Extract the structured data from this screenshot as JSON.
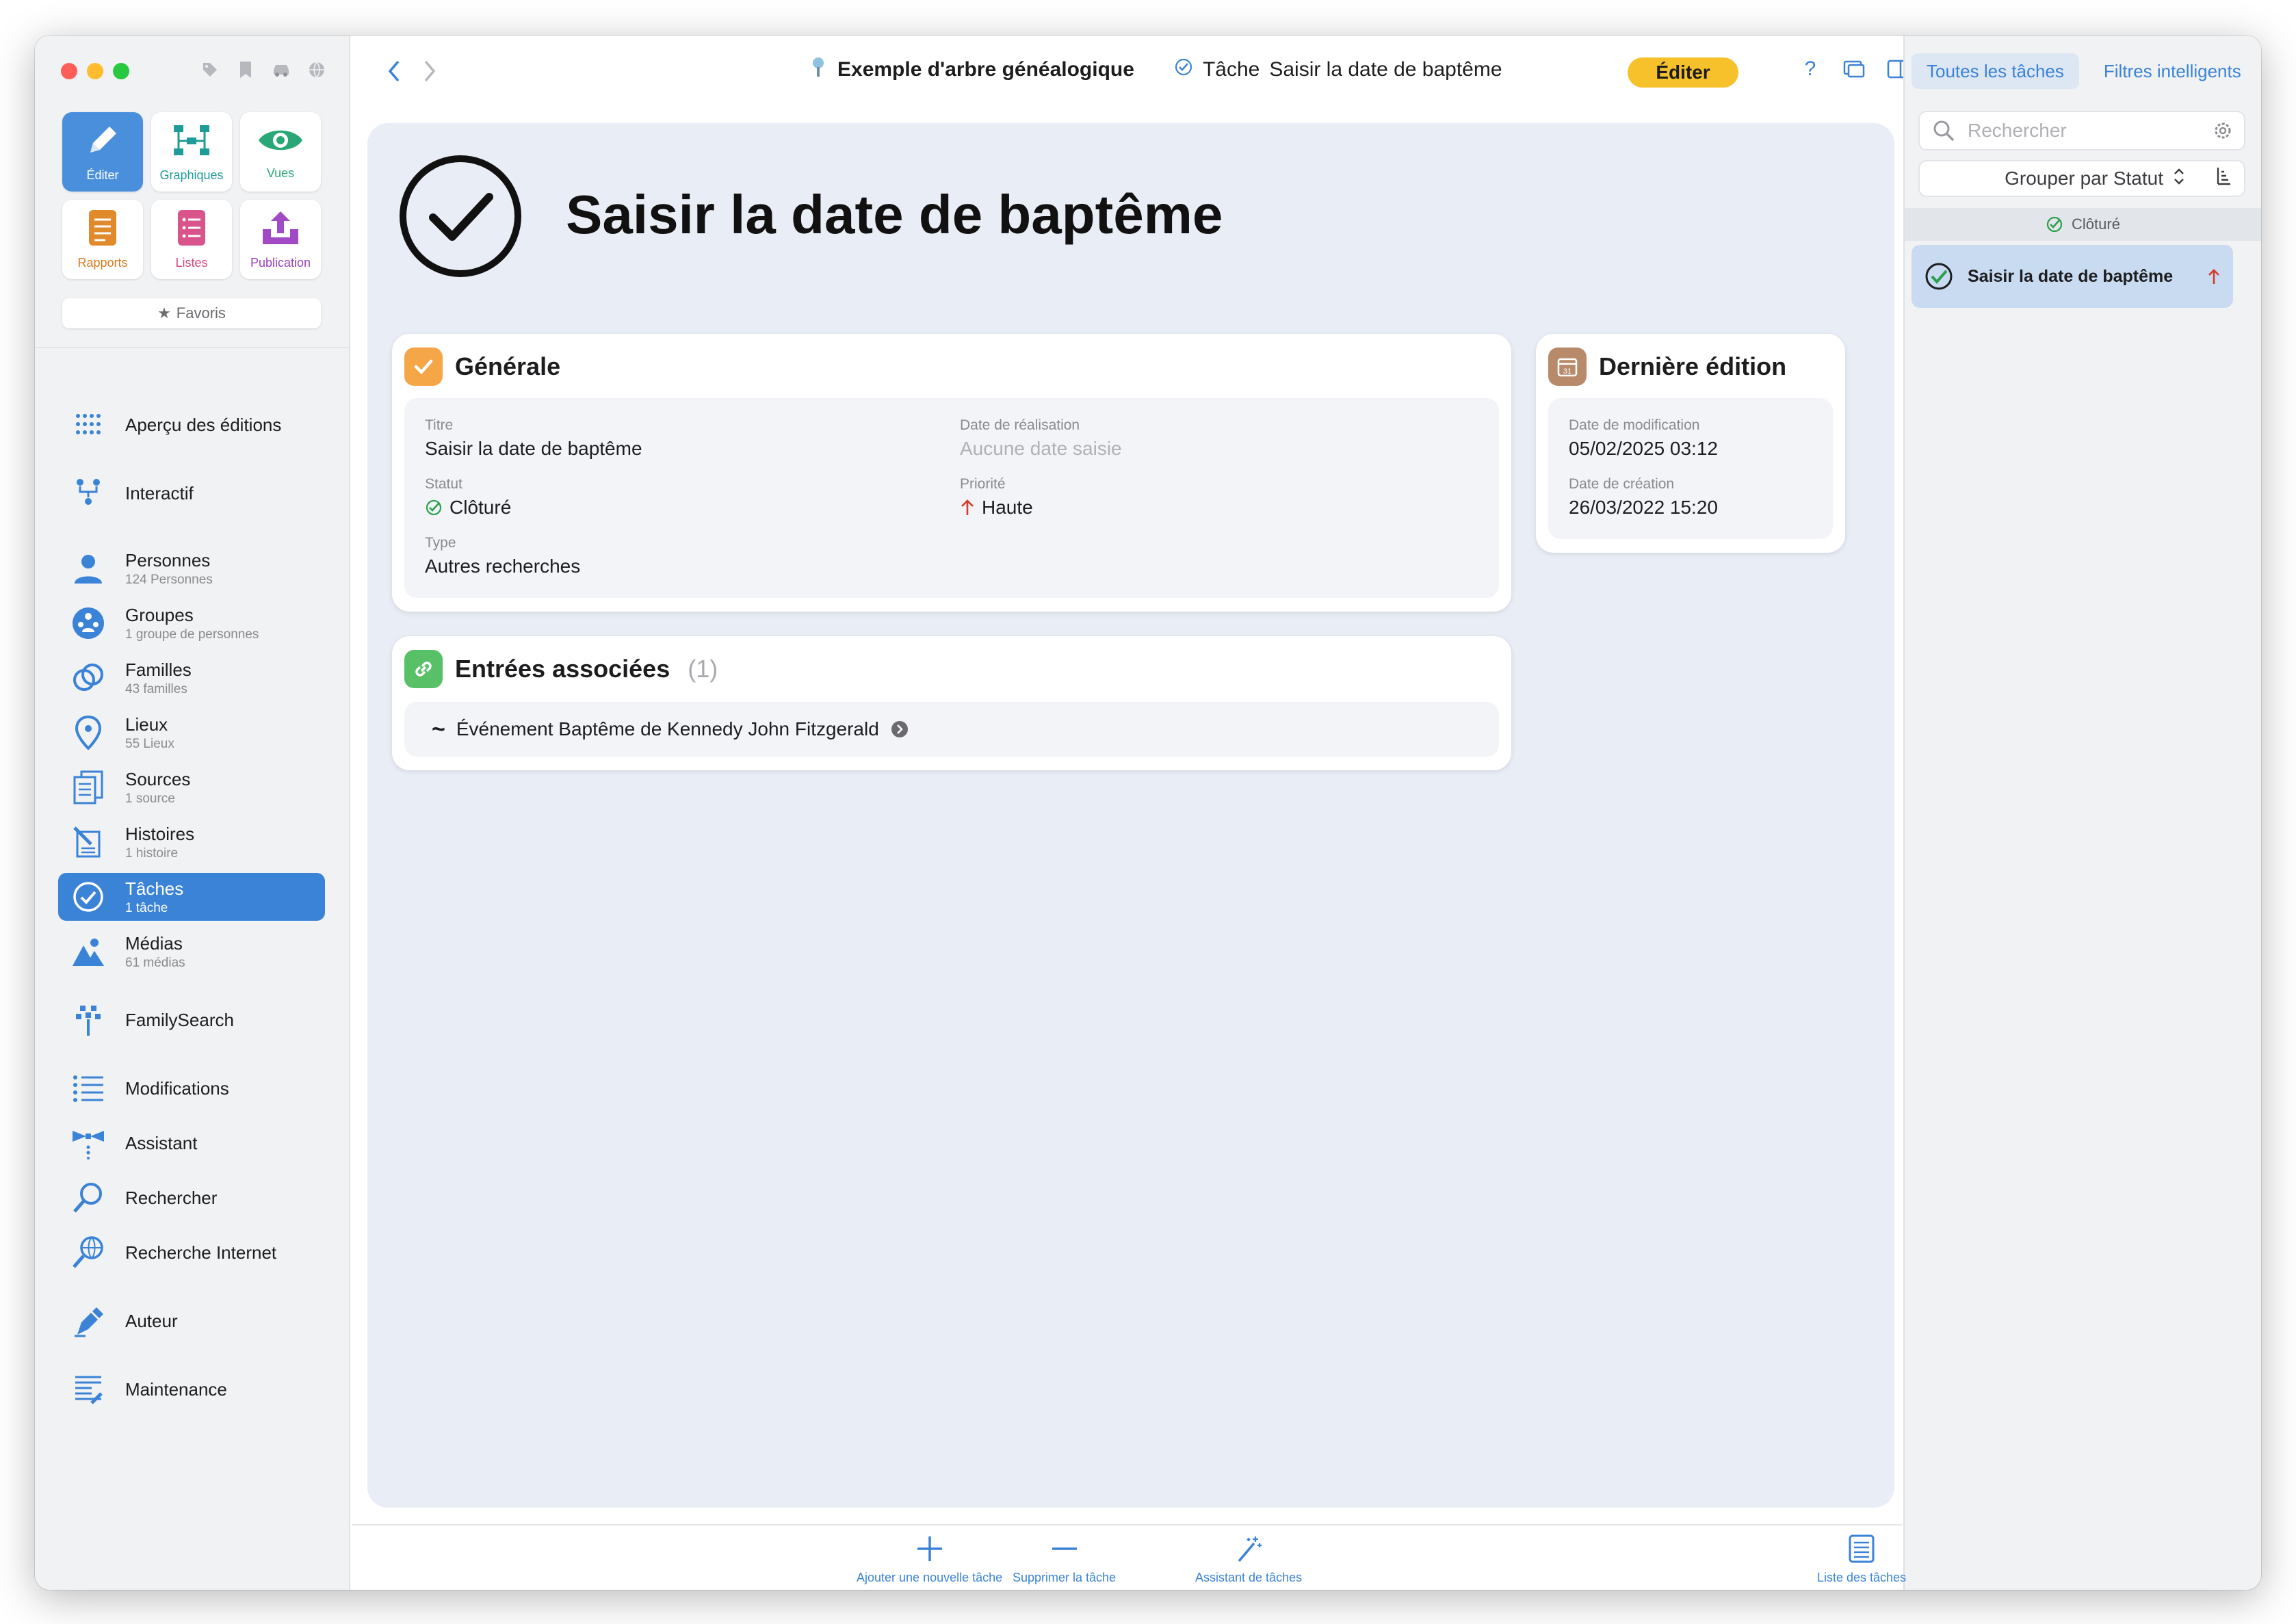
{
  "toolbar": {
    "document_title": "Exemple d'arbre généalogique",
    "task_prefix": "Tâche",
    "task_title": "Saisir la date de baptême",
    "edit_button": "Éditer",
    "help": "?"
  },
  "sidebar": {
    "tools": [
      {
        "label": "Éditer",
        "color": "#ffffff"
      },
      {
        "label": "Graphiques",
        "color": "#1f9c9a"
      },
      {
        "label": "Vues",
        "color": "#2aa776"
      },
      {
        "label": "Rapports",
        "color": "#d67a1e"
      },
      {
        "label": "Listes",
        "color": "#d0457a"
      },
      {
        "label": "Publication",
        "color": "#9b3fbf"
      }
    ],
    "favorites": "Favoris",
    "items": [
      {
        "label": "Aperçu des éditions",
        "sub": ""
      },
      {
        "label": "Interactif",
        "sub": ""
      },
      {
        "label": "Personnes",
        "sub": "124 Personnes"
      },
      {
        "label": "Groupes",
        "sub": "1 groupe de personnes"
      },
      {
        "label": "Familles",
        "sub": "43 familles"
      },
      {
        "label": "Lieux",
        "sub": "55 Lieux"
      },
      {
        "label": "Sources",
        "sub": "1 source"
      },
      {
        "label": "Histoires",
        "sub": "1 histoire"
      },
      {
        "label": "Tâches",
        "sub": "1 tâche"
      },
      {
        "label": "Médias",
        "sub": "61 médias"
      },
      {
        "label": "FamilySearch",
        "sub": ""
      },
      {
        "label": "Modifications",
        "sub": ""
      },
      {
        "label": "Assistant",
        "sub": ""
      },
      {
        "label": "Rechercher",
        "sub": ""
      },
      {
        "label": "Recherche Internet",
        "sub": ""
      },
      {
        "label": "Auteur",
        "sub": ""
      },
      {
        "label": "Maintenance",
        "sub": ""
      }
    ]
  },
  "main": {
    "title": "Saisir la date de baptême",
    "general": {
      "heading": "Générale",
      "title_label": "Titre",
      "title_value": "Saisir la date de baptême",
      "date_label": "Date de réalisation",
      "date_value": "Aucune date saisie",
      "status_label": "Statut",
      "status_value": "Clôturé",
      "priority_label": "Priorité",
      "priority_value": "Haute",
      "type_label": "Type",
      "type_value": "Autres recherches"
    },
    "last_edit": {
      "heading": "Dernière édition",
      "modified_label": "Date de modification",
      "modified_value": "05/02/2025 03:12",
      "created_label": "Date de création",
      "created_value": "26/03/2022 15:20"
    },
    "associated": {
      "heading": "Entrées associées",
      "count": "(1)",
      "entry": "Événement Baptême de Kennedy John Fitzgerald"
    }
  },
  "right_panel": {
    "tab_all": "Toutes les tâches",
    "tab_smart": "Filtres intelligents",
    "search_placeholder": "Rechercher",
    "group_by": "Grouper par Statut",
    "section": "Clôturé",
    "row_title": "Saisir la date de baptême"
  },
  "bottom": {
    "add": "Ajouter une nouvelle tâche",
    "remove": "Supprimer la tâche",
    "assistant": "Assistant de tâches",
    "list": "Liste des tâches"
  },
  "colors": {
    "accent": "#3a83d6",
    "edit_button": "#f6c12b",
    "status_check": "#2aa04a",
    "priority_arrow": "#d63a2a"
  }
}
